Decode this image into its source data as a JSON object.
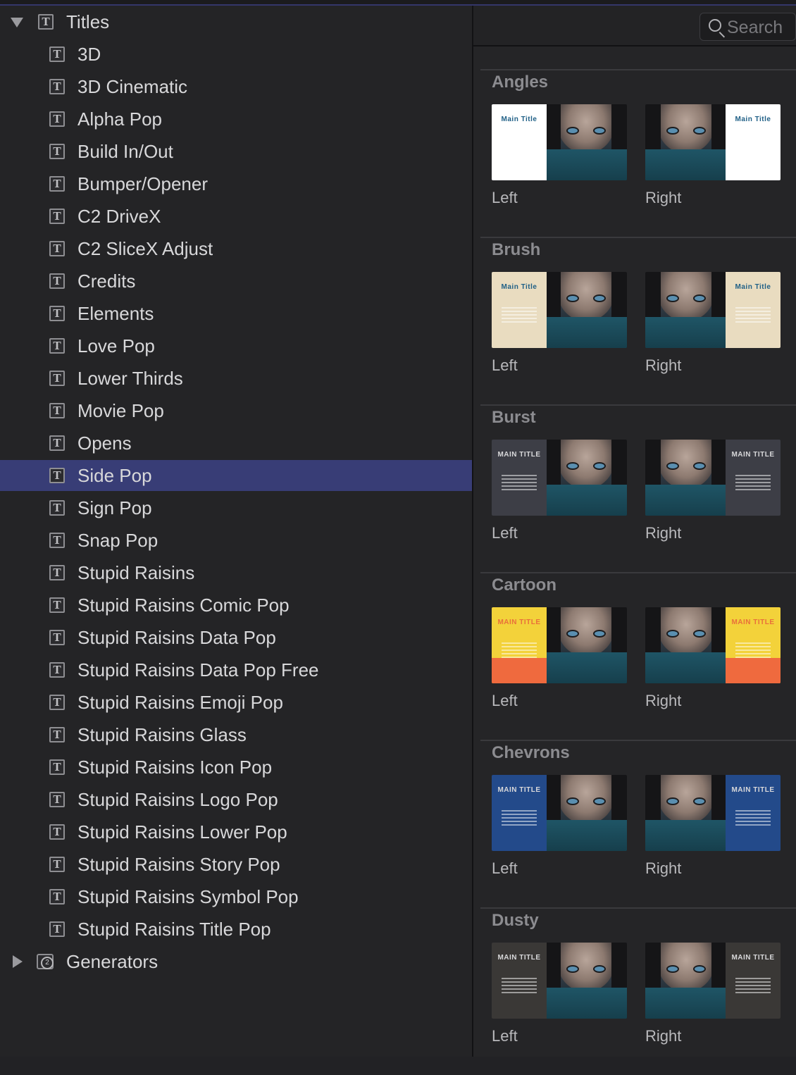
{
  "sidebar": {
    "root_label": "Titles",
    "items": [
      "3D",
      "3D Cinematic",
      "Alpha Pop",
      "Build In/Out",
      "Bumper/Opener",
      "C2 DriveX",
      "C2 SliceX Adjust",
      "Credits",
      "Elements",
      "Love Pop",
      "Lower Thirds",
      "Movie Pop",
      "Opens",
      "Side Pop",
      "Sign Pop",
      "Snap Pop",
      "Stupid Raisins",
      "Stupid Raisins Comic Pop",
      "Stupid Raisins Data Pop",
      "Stupid Raisins Data Pop Free",
      "Stupid Raisins Emoji Pop",
      "Stupid Raisins Glass",
      "Stupid Raisins Icon Pop",
      "Stupid Raisins Logo Pop",
      "Stupid Raisins Lower Pop",
      "Stupid Raisins Story Pop",
      "Stupid Raisins Symbol Pop",
      "Stupid Raisins Title Pop"
    ],
    "selected_item": "Side Pop",
    "generators_label": "Generators",
    "title_icon_glyph": "T",
    "generators_icon_glyph": "2"
  },
  "search": {
    "placeholder": "Search"
  },
  "browser": {
    "sections": [
      {
        "title": "Angles",
        "left_label": "Left",
        "right_label": "Right",
        "card_text": "Main Title",
        "card_color": "#ffffff"
      },
      {
        "title": "Brush",
        "left_label": "Left",
        "right_label": "Right",
        "card_text": "Main Title",
        "card_color": "#e9dcc0"
      },
      {
        "title": "Burst",
        "left_label": "Left",
        "right_label": "Right",
        "card_text": "MAIN TITLE",
        "card_color": "#3d3e46"
      },
      {
        "title": "Cartoon",
        "left_label": "Left",
        "right_label": "Right",
        "card_text": "MAIN TITLE",
        "card_color": "#f3d23a"
      },
      {
        "title": "Chevrons",
        "left_label": "Left",
        "right_label": "Right",
        "card_text": "MAIN TITLE",
        "card_color": "#234a8a"
      },
      {
        "title": "Dusty",
        "left_label": "Left",
        "right_label": "Right",
        "card_text": "MAIN TITLE",
        "card_color": "#3a3836"
      }
    ]
  },
  "colors": {
    "selected_row": "#383d76",
    "sidebar_bg": "#242426",
    "panel_bg": "#252527"
  }
}
